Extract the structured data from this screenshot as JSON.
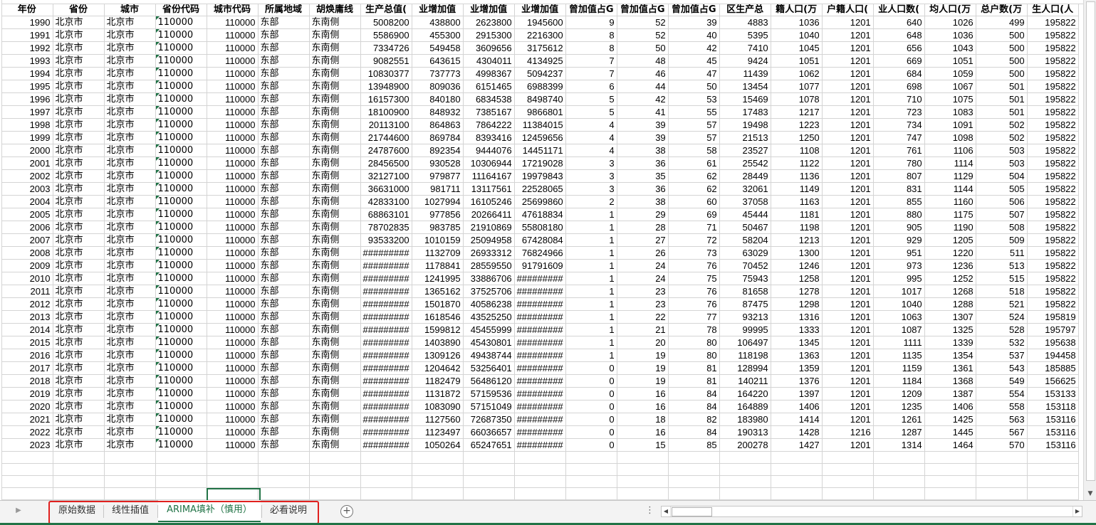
{
  "sheet": {
    "headers": [
      "年份",
      "省份",
      "城市",
      "省份代码",
      "城市代码",
      "所属地域",
      "胡焕庸线",
      "生产总值(",
      "业增加值",
      "业增加值",
      "业增加值",
      "曾加值占G",
      "曾加值占G",
      "曾加值占G",
      "区生产总",
      "籍人口(万",
      "户籍人口(",
      "业人口数(",
      "均人口(万",
      "总户数(万",
      "生人口(人"
    ],
    "rows": [
      [
        "1990",
        "北京市",
        "北京市",
        "110000",
        "110000",
        "东部",
        "东南侧",
        "5008200",
        "438800",
        "2623800",
        "1945600",
        "9",
        "52",
        "39",
        "4883",
        "1036",
        "1201",
        "640",
        "1026",
        "499",
        "195822"
      ],
      [
        "1991",
        "北京市",
        "北京市",
        "110000",
        "110000",
        "东部",
        "东南侧",
        "5586900",
        "455300",
        "2915300",
        "2216300",
        "8",
        "52",
        "40",
        "5395",
        "1040",
        "1201",
        "648",
        "1036",
        "500",
        "195822"
      ],
      [
        "1992",
        "北京市",
        "北京市",
        "110000",
        "110000",
        "东部",
        "东南侧",
        "7334726",
        "549458",
        "3609656",
        "3175612",
        "8",
        "50",
        "42",
        "7410",
        "1045",
        "1201",
        "656",
        "1043",
        "500",
        "195822"
      ],
      [
        "1993",
        "北京市",
        "北京市",
        "110000",
        "110000",
        "东部",
        "东南侧",
        "9082551",
        "643615",
        "4304011",
        "4134925",
        "7",
        "48",
        "45",
        "9424",
        "1051",
        "1201",
        "669",
        "1051",
        "500",
        "195822"
      ],
      [
        "1994",
        "北京市",
        "北京市",
        "110000",
        "110000",
        "东部",
        "东南侧",
        "10830377",
        "737773",
        "4998367",
        "5094237",
        "7",
        "46",
        "47",
        "11439",
        "1062",
        "1201",
        "684",
        "1059",
        "500",
        "195822"
      ],
      [
        "1995",
        "北京市",
        "北京市",
        "110000",
        "110000",
        "东部",
        "东南侧",
        "13948900",
        "809036",
        "6151465",
        "6988399",
        "6",
        "44",
        "50",
        "13454",
        "1077",
        "1201",
        "698",
        "1067",
        "501",
        "195822"
      ],
      [
        "1996",
        "北京市",
        "北京市",
        "110000",
        "110000",
        "东部",
        "东南侧",
        "16157300",
        "840180",
        "6834538",
        "8498740",
        "5",
        "42",
        "53",
        "15469",
        "1078",
        "1201",
        "710",
        "1075",
        "501",
        "195822"
      ],
      [
        "1997",
        "北京市",
        "北京市",
        "110000",
        "110000",
        "东部",
        "东南侧",
        "18100900",
        "848932",
        "7385167",
        "9866801",
        "5",
        "41",
        "55",
        "17483",
        "1217",
        "1201",
        "723",
        "1083",
        "501",
        "195822"
      ],
      [
        "1998",
        "北京市",
        "北京市",
        "110000",
        "110000",
        "东部",
        "东南侧",
        "20113100",
        "864863",
        "7864222",
        "11384015",
        "4",
        "39",
        "57",
        "19498",
        "1223",
        "1201",
        "734",
        "1091",
        "502",
        "195822"
      ],
      [
        "1999",
        "北京市",
        "北京市",
        "110000",
        "110000",
        "东部",
        "东南侧",
        "21744600",
        "869784",
        "8393416",
        "12459656",
        "4",
        "39",
        "57",
        "21513",
        "1250",
        "1201",
        "747",
        "1098",
        "502",
        "195822"
      ],
      [
        "2000",
        "北京市",
        "北京市",
        "110000",
        "110000",
        "东部",
        "东南侧",
        "24787600",
        "892354",
        "9444076",
        "14451171",
        "4",
        "38",
        "58",
        "23527",
        "1108",
        "1201",
        "761",
        "1106",
        "503",
        "195822"
      ],
      [
        "2001",
        "北京市",
        "北京市",
        "110000",
        "110000",
        "东部",
        "东南侧",
        "28456500",
        "930528",
        "10306944",
        "17219028",
        "3",
        "36",
        "61",
        "25542",
        "1122",
        "1201",
        "780",
        "1114",
        "503",
        "195822"
      ],
      [
        "2002",
        "北京市",
        "北京市",
        "110000",
        "110000",
        "东部",
        "东南侧",
        "32127100",
        "979877",
        "11164167",
        "19979843",
        "3",
        "35",
        "62",
        "28449",
        "1136",
        "1201",
        "807",
        "1129",
        "504",
        "195822"
      ],
      [
        "2003",
        "北京市",
        "北京市",
        "110000",
        "110000",
        "东部",
        "东南侧",
        "36631000",
        "981711",
        "13117561",
        "22528065",
        "3",
        "36",
        "62",
        "32061",
        "1149",
        "1201",
        "831",
        "1144",
        "505",
        "195822"
      ],
      [
        "2004",
        "北京市",
        "北京市",
        "110000",
        "110000",
        "东部",
        "东南侧",
        "42833100",
        "1027994",
        "16105246",
        "25699860",
        "2",
        "38",
        "60",
        "37058",
        "1163",
        "1201",
        "855",
        "1160",
        "506",
        "195822"
      ],
      [
        "2005",
        "北京市",
        "北京市",
        "110000",
        "110000",
        "东部",
        "东南侧",
        "68863101",
        "977856",
        "20266411",
        "47618834",
        "1",
        "29",
        "69",
        "45444",
        "1181",
        "1201",
        "880",
        "1175",
        "507",
        "195822"
      ],
      [
        "2006",
        "北京市",
        "北京市",
        "110000",
        "110000",
        "东部",
        "东南侧",
        "78702835",
        "983785",
        "21910869",
        "55808180",
        "1",
        "28",
        "71",
        "50467",
        "1198",
        "1201",
        "905",
        "1190",
        "508",
        "195822"
      ],
      [
        "2007",
        "北京市",
        "北京市",
        "110000",
        "110000",
        "东部",
        "东南侧",
        "93533200",
        "1010159",
        "25094958",
        "67428084",
        "1",
        "27",
        "72",
        "58204",
        "1213",
        "1201",
        "929",
        "1205",
        "509",
        "195822"
      ],
      [
        "2008",
        "北京市",
        "北京市",
        "110000",
        "110000",
        "东部",
        "东南侧",
        "#########",
        "1132709",
        "26933312",
        "76824966",
        "1",
        "26",
        "73",
        "63029",
        "1300",
        "1201",
        "951",
        "1220",
        "511",
        "195822"
      ],
      [
        "2009",
        "北京市",
        "北京市",
        "110000",
        "110000",
        "东部",
        "东南侧",
        "#########",
        "1178841",
        "28559550",
        "91791609",
        "1",
        "24",
        "76",
        "70452",
        "1246",
        "1201",
        "973",
        "1236",
        "513",
        "195822"
      ],
      [
        "2010",
        "北京市",
        "北京市",
        "110000",
        "110000",
        "东部",
        "东南侧",
        "#########",
        "1241995",
        "33886706",
        "#########",
        "1",
        "24",
        "75",
        "75943",
        "1258",
        "1201",
        "995",
        "1252",
        "515",
        "195822"
      ],
      [
        "2011",
        "北京市",
        "北京市",
        "110000",
        "110000",
        "东部",
        "东南侧",
        "#########",
        "1365162",
        "37525706",
        "#########",
        "1",
        "23",
        "76",
        "81658",
        "1278",
        "1201",
        "1017",
        "1268",
        "518",
        "195822"
      ],
      [
        "2012",
        "北京市",
        "北京市",
        "110000",
        "110000",
        "东部",
        "东南侧",
        "#########",
        "1501870",
        "40586238",
        "#########",
        "1",
        "23",
        "76",
        "87475",
        "1298",
        "1201",
        "1040",
        "1288",
        "521",
        "195822"
      ],
      [
        "2013",
        "北京市",
        "北京市",
        "110000",
        "110000",
        "东部",
        "东南侧",
        "#########",
        "1618546",
        "43525250",
        "#########",
        "1",
        "22",
        "77",
        "93213",
        "1316",
        "1201",
        "1063",
        "1307",
        "524",
        "195819"
      ],
      [
        "2014",
        "北京市",
        "北京市",
        "110000",
        "110000",
        "东部",
        "东南侧",
        "#########",
        "1599812",
        "45455999",
        "#########",
        "1",
        "21",
        "78",
        "99995",
        "1333",
        "1201",
        "1087",
        "1325",
        "528",
        "195797"
      ],
      [
        "2015",
        "北京市",
        "北京市",
        "110000",
        "110000",
        "东部",
        "东南侧",
        "#########",
        "1403890",
        "45430801",
        "#########",
        "1",
        "20",
        "80",
        "106497",
        "1345",
        "1201",
        "1111",
        "1339",
        "532",
        "195638"
      ],
      [
        "2016",
        "北京市",
        "北京市",
        "110000",
        "110000",
        "东部",
        "东南侧",
        "#########",
        "1309126",
        "49438744",
        "#########",
        "1",
        "19",
        "80",
        "118198",
        "1363",
        "1201",
        "1135",
        "1354",
        "537",
        "194458"
      ],
      [
        "2017",
        "北京市",
        "北京市",
        "110000",
        "110000",
        "东部",
        "东南侧",
        "#########",
        "1204642",
        "53256401",
        "#########",
        "0",
        "19",
        "81",
        "128994",
        "1359",
        "1201",
        "1159",
        "1361",
        "543",
        "185885"
      ],
      [
        "2018",
        "北京市",
        "北京市",
        "110000",
        "110000",
        "东部",
        "东南侧",
        "#########",
        "1182479",
        "56486120",
        "#########",
        "0",
        "19",
        "81",
        "140211",
        "1376",
        "1201",
        "1184",
        "1368",
        "549",
        "156625"
      ],
      [
        "2019",
        "北京市",
        "北京市",
        "110000",
        "110000",
        "东部",
        "东南侧",
        "#########",
        "1131872",
        "57159536",
        "#########",
        "0",
        "16",
        "84",
        "164220",
        "1397",
        "1201",
        "1209",
        "1387",
        "554",
        "153133"
      ],
      [
        "2020",
        "北京市",
        "北京市",
        "110000",
        "110000",
        "东部",
        "东南侧",
        "#########",
        "1083090",
        "57151049",
        "#########",
        "0",
        "16",
        "84",
        "164889",
        "1406",
        "1201",
        "1235",
        "1406",
        "558",
        "153118"
      ],
      [
        "2021",
        "北京市",
        "北京市",
        "110000",
        "110000",
        "东部",
        "东南侧",
        "#########",
        "1127560",
        "72687350",
        "#########",
        "0",
        "18",
        "82",
        "183980",
        "1414",
        "1201",
        "1261",
        "1425",
        "563",
        "153116"
      ],
      [
        "2022",
        "北京市",
        "北京市",
        "110000",
        "110000",
        "东部",
        "东南侧",
        "#########",
        "1123497",
        "66036657",
        "#########",
        "0",
        "16",
        "84",
        "190313",
        "1428",
        "1216",
        "1287",
        "1445",
        "567",
        "153116"
      ],
      [
        "2023",
        "北京市",
        "北京市",
        "110000",
        "110000",
        "东部",
        "东南侧",
        "#########",
        "1050264",
        "65247651",
        "#########",
        "0",
        "15",
        "85",
        "200278",
        "1427",
        "1201",
        "1314",
        "1464",
        "570",
        "153116"
      ]
    ]
  },
  "tabs": [
    {
      "label": "原始数据",
      "active": false
    },
    {
      "label": "线性插值",
      "active": false
    },
    {
      "label": "ARIMA填补（慎用）",
      "active": true
    },
    {
      "label": "必看说明",
      "active": false
    }
  ],
  "statusbar": {
    "add_sheet": "+",
    "more": "⋮"
  },
  "colors": {
    "accent": "#217346",
    "highlight_box": "#e0201e"
  }
}
